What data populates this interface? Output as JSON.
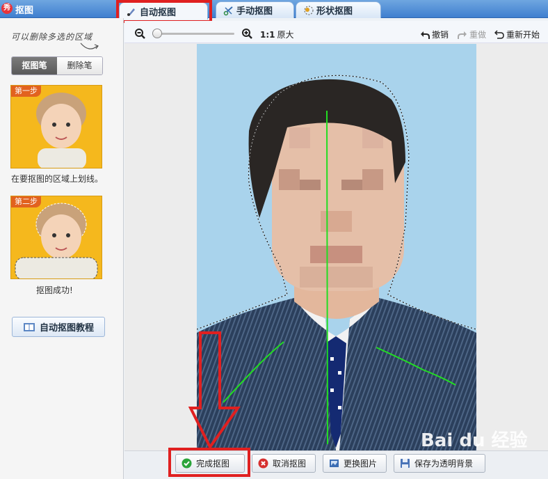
{
  "window": {
    "title": "抠图",
    "icon": "meitu-app-icon"
  },
  "tabs": [
    {
      "label": "自动抠图",
      "icon": "brush-icon",
      "active": true
    },
    {
      "label": "手动抠图",
      "icon": "scissors-icon",
      "active": false
    },
    {
      "label": "形状抠图",
      "icon": "shape-icon",
      "active": false
    }
  ],
  "left_panel": {
    "hint": "可以删除多选的区域",
    "modes": [
      {
        "label": "抠图笔",
        "selected": true
      },
      {
        "label": "删除笔",
        "selected": false
      }
    ],
    "step1": {
      "badge": "第一步",
      "caption": "在要抠图的区域上划线。"
    },
    "step2": {
      "badge": "第二步",
      "caption": "抠图成功!"
    },
    "tutorial_button": "自动抠图教程"
  },
  "toolbar": {
    "zoom_out_icon": "zoom-out-icon",
    "zoom_in_icon": "zoom-in-icon",
    "zoom_level": 0.1,
    "actual_size_ratio": "1:1",
    "actual_size_label": "原大",
    "undo": "撤销",
    "redo": "重做",
    "restart": "重新开始"
  },
  "bottom_buttons": [
    {
      "label": "完成抠图",
      "icon": "check-icon"
    },
    {
      "label": "取消抠图",
      "icon": "cancel-icon"
    },
    {
      "label": "更换图片",
      "icon": "image-icon"
    },
    {
      "label": "保存为透明背景",
      "icon": "save-icon"
    }
  ],
  "watermark": "Bai du 经验",
  "colors": {
    "highlight": "#e02020",
    "stroke": "#22dd22",
    "photo_bg": "#a9d3ec"
  }
}
